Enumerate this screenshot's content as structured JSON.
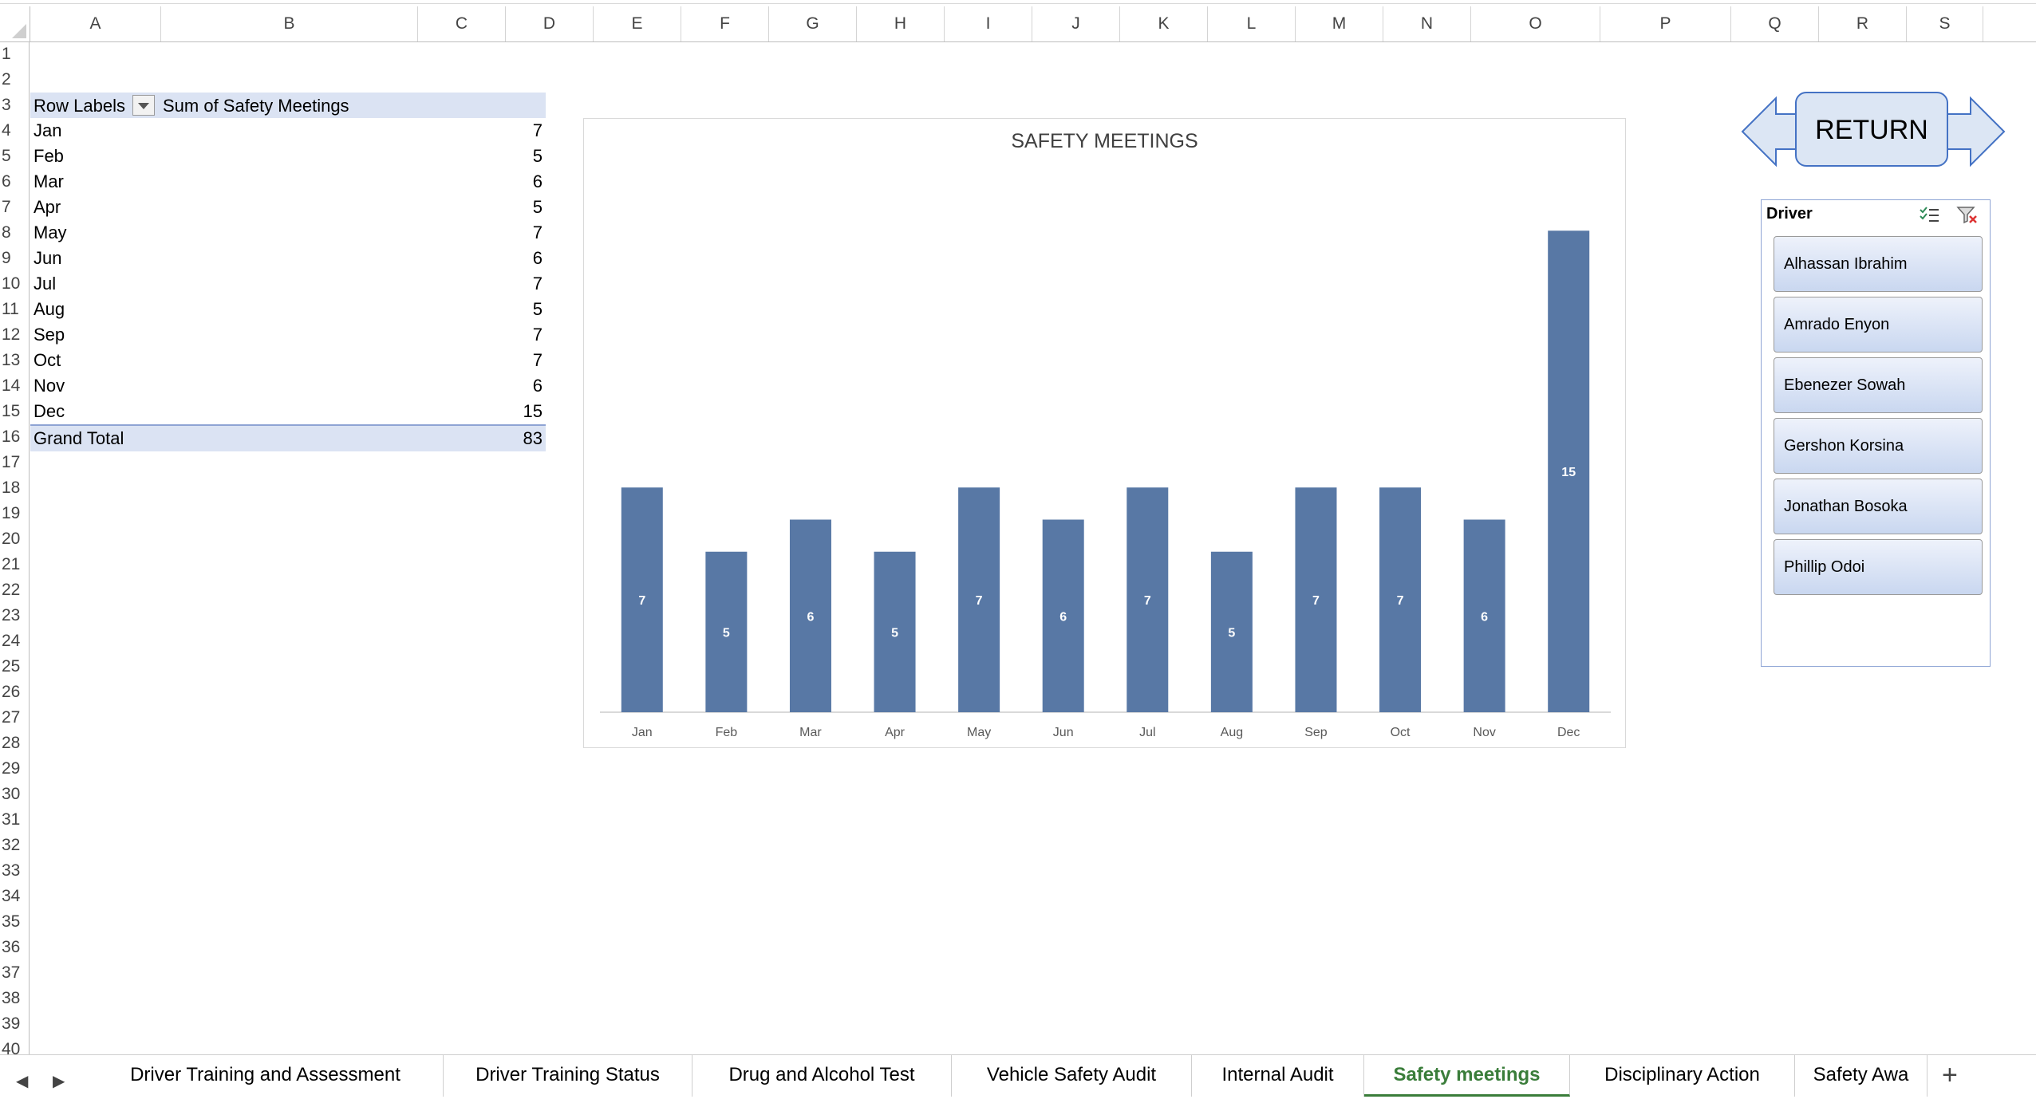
{
  "columns": [
    "A",
    "B",
    "C",
    "D",
    "E",
    "F",
    "G",
    "H",
    "I",
    "J",
    "K",
    "L",
    "M",
    "N",
    "O",
    "P",
    "Q",
    "R",
    "S"
  ],
  "rows": [
    "1",
    "2",
    "3",
    "4",
    "5",
    "6",
    "7",
    "8",
    "9",
    "10",
    "11",
    "12",
    "13",
    "14",
    "15",
    "16",
    "17",
    "18",
    "19",
    "20",
    "21",
    "22",
    "23",
    "24",
    "25",
    "26",
    "27",
    "28",
    "29",
    "30",
    "31",
    "32",
    "33",
    "34",
    "35",
    "36",
    "37",
    "38",
    "39",
    "40"
  ],
  "pivot": {
    "header_labels": "Row Labels",
    "header_values": "Sum of Safety Meetings",
    "rows": [
      {
        "label": "Jan",
        "value": "7"
      },
      {
        "label": "Feb",
        "value": "5"
      },
      {
        "label": "Mar",
        "value": "6"
      },
      {
        "label": "Apr",
        "value": "5"
      },
      {
        "label": "May",
        "value": "7"
      },
      {
        "label": "Jun",
        "value": "6"
      },
      {
        "label": "Jul",
        "value": "7"
      },
      {
        "label": "Aug",
        "value": "5"
      },
      {
        "label": "Sep",
        "value": "7"
      },
      {
        "label": "Oct",
        "value": "7"
      },
      {
        "label": "Nov",
        "value": "6"
      },
      {
        "label": "Dec",
        "value": "15"
      }
    ],
    "total_label": "Grand Total",
    "total_value": "83"
  },
  "chart_data": {
    "type": "bar",
    "title": "SAFETY MEETINGS",
    "categories": [
      "Jan",
      "Feb",
      "Mar",
      "Apr",
      "May",
      "Jun",
      "Jul",
      "Aug",
      "Sep",
      "Oct",
      "Nov",
      "Dec"
    ],
    "values": [
      7,
      5,
      6,
      5,
      7,
      6,
      7,
      5,
      7,
      7,
      6,
      15
    ],
    "xlabel": "",
    "ylabel": "",
    "ylim": [
      0,
      16
    ],
    "grid": false,
    "legend": "none",
    "data_labels": true,
    "bar_color": "#5878a5"
  },
  "return_button": {
    "label": "RETURN"
  },
  "slicer": {
    "title": "Driver",
    "items": [
      "Alhassan Ibrahim",
      "Amrado Enyon",
      "Ebenezer Sowah",
      "Gershon Korsina",
      "Jonathan Bosoka",
      "Phillip Odoi"
    ]
  },
  "tabs": [
    {
      "label": "Driver Training and Assessment",
      "active": false
    },
    {
      "label": "Driver Training Status",
      "active": false
    },
    {
      "label": "Drug and Alcohol Test",
      "active": false
    },
    {
      "label": "Vehicle Safety Audit",
      "active": false
    },
    {
      "label": "Internal Audit",
      "active": false
    },
    {
      "label": "Safety meetings",
      "active": true
    },
    {
      "label": "Disciplinary Action",
      "active": false
    },
    {
      "label": "Safety Awa",
      "active": false
    }
  ],
  "colors": {
    "accent": "#4472c4",
    "active_tab": "#3a7d3a",
    "pivot_band": "#dbe3f3"
  }
}
